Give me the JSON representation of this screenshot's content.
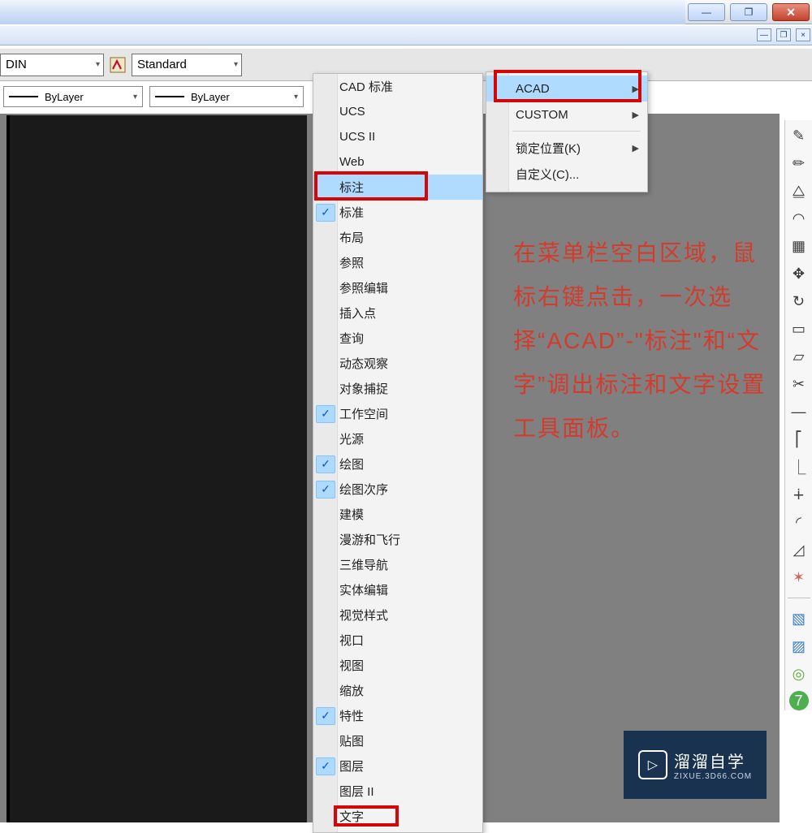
{
  "window": {
    "min_glyph": "—",
    "max_glyph": "❐",
    "close_glyph": "✕",
    "sub_min": "—",
    "sub_max": "❐",
    "sub_close": "×"
  },
  "toolbar1": {
    "style_combo": "DIN",
    "text_style": "Standard"
  },
  "toolbar2": {
    "layer1": "ByLayer",
    "layer2": "ByLayer"
  },
  "ctx": {
    "items": [
      {
        "label": "CAD 标准",
        "checked": false
      },
      {
        "label": "UCS",
        "checked": false
      },
      {
        "label": "UCS II",
        "checked": false
      },
      {
        "label": "Web",
        "checked": false
      },
      {
        "label": "标注",
        "checked": false,
        "sel": true
      },
      {
        "label": "标准",
        "checked": true
      },
      {
        "label": "布局",
        "checked": false
      },
      {
        "label": "参照",
        "checked": false
      },
      {
        "label": "参照编辑",
        "checked": false
      },
      {
        "label": "插入点",
        "checked": false
      },
      {
        "label": "查询",
        "checked": false
      },
      {
        "label": "动态观察",
        "checked": false
      },
      {
        "label": "对象捕捉",
        "checked": false
      },
      {
        "label": "工作空间",
        "checked": true
      },
      {
        "label": "光源",
        "checked": false
      },
      {
        "label": "绘图",
        "checked": true
      },
      {
        "label": "绘图次序",
        "checked": true
      },
      {
        "label": "建模",
        "checked": false
      },
      {
        "label": "漫游和飞行",
        "checked": false
      },
      {
        "label": "三维导航",
        "checked": false
      },
      {
        "label": "实体编辑",
        "checked": false
      },
      {
        "label": "视觉样式",
        "checked": false
      },
      {
        "label": "视口",
        "checked": false
      },
      {
        "label": "视图",
        "checked": false
      },
      {
        "label": "缩放",
        "checked": false
      },
      {
        "label": "特性",
        "checked": true
      },
      {
        "label": "贴图",
        "checked": false
      },
      {
        "label": "图层",
        "checked": true
      },
      {
        "label": "图层 II",
        "checked": false
      },
      {
        "label": "文字",
        "checked": false
      }
    ]
  },
  "submenu": {
    "items": [
      {
        "label": "ACAD",
        "sel": true,
        "caret": true
      },
      {
        "label": "CUSTOM",
        "caret": true
      },
      {
        "sep": true
      },
      {
        "label": "锁定位置(K)",
        "caret": true
      },
      {
        "label": "自定义(C)..."
      }
    ]
  },
  "annotation": "在菜单栏空白区域，鼠标右键点击，一次选择“ACAD”-\"标注\"和“文字”调出标注和文字设置工具面板。",
  "watermark": {
    "title": "溜溜自学",
    "sub": "ZIXUE.3D66.COM",
    "play": "▷"
  }
}
